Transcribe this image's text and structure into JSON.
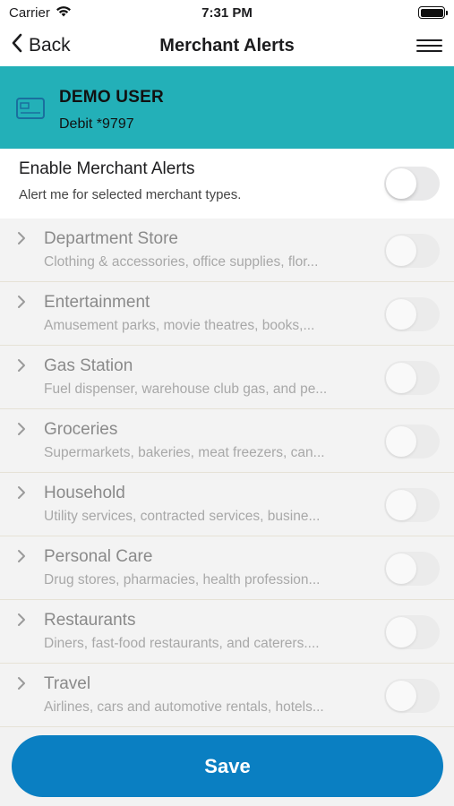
{
  "status_bar": {
    "carrier": "Carrier",
    "time": "7:31 PM",
    "wifi_icon": "wifi-icon",
    "battery_icon": "battery-icon"
  },
  "nav": {
    "back_label": "Back",
    "title": "Merchant Alerts",
    "menu_icon": "hamburger-menu-icon"
  },
  "account": {
    "name": "DEMO USER",
    "subtitle": "Debit *9797",
    "icon": "credit-card-icon",
    "banner_color": "#23b0b8"
  },
  "enable": {
    "title": "Enable Merchant Alerts",
    "subtitle": "Alert me for selected merchant types.",
    "enabled": false
  },
  "categories": [
    {
      "name": "Department Store",
      "description": "Clothing & accessories, office supplies, flor...",
      "enabled": false
    },
    {
      "name": "Entertainment",
      "description": "Amusement parks, movie theatres, books,...",
      "enabled": false
    },
    {
      "name": "Gas Station",
      "description": "Fuel dispenser, warehouse club gas, and pe...",
      "enabled": false
    },
    {
      "name": "Groceries",
      "description": "Supermarkets, bakeries, meat freezers, can...",
      "enabled": false
    },
    {
      "name": "Household",
      "description": "Utility services, contracted services, busine...",
      "enabled": false
    },
    {
      "name": "Personal Care",
      "description": "Drug stores, pharmacies, health profession...",
      "enabled": false
    },
    {
      "name": "Restaurants",
      "description": "Diners, fast-food restaurants, and caterers....",
      "enabled": false
    },
    {
      "name": "Travel",
      "description": "Airlines, cars and automotive rentals, hotels...",
      "enabled": false
    }
  ],
  "save_label": "Save",
  "colors": {
    "accent": "#0a7fc2",
    "banner": "#23b0b8"
  }
}
